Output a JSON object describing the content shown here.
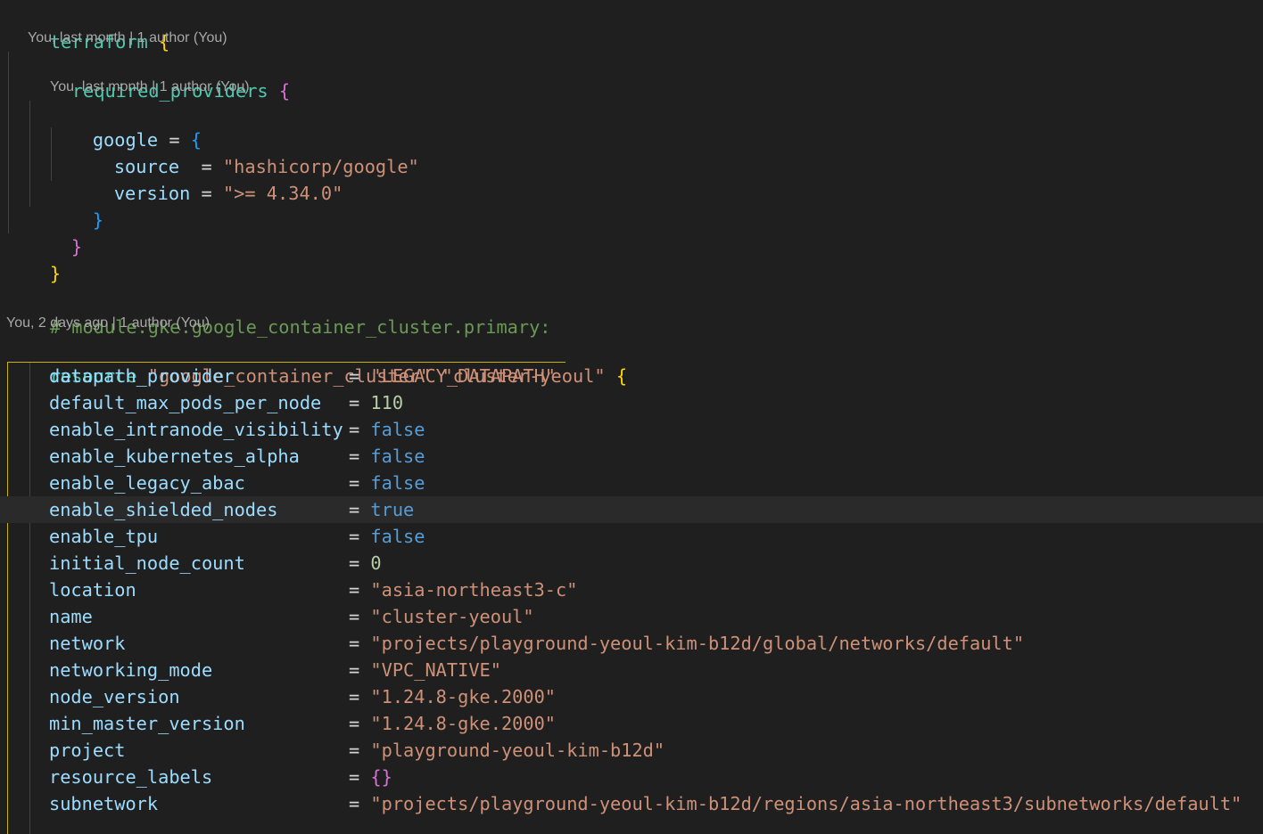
{
  "terraform_block": {
    "keyword": "terraform",
    "lens": "You, last month | 1 author (You)",
    "required_providers": {
      "keyword": "required_providers",
      "lens": "You, last month | 1 author (You)",
      "google": {
        "key": "google",
        "source_key": "source",
        "source_value": "\"hashicorp/google\"",
        "version_key": "version",
        "version_value": "\">= 4.34.0\""
      }
    }
  },
  "comment": "# module.gke.google_container_cluster.primary:",
  "resource_lens": "You, 2 days ago | 1 author (You)",
  "resource": {
    "keyword": "resource",
    "type": "\"google_container_cluster\"",
    "name": "\"cluster-yeoul\"",
    "attributes": [
      {
        "key": "datapath_provider",
        "value": "\"LEGACY_DATAPATH\"",
        "kind": "str"
      },
      {
        "key": "default_max_pods_per_node",
        "value": "110",
        "kind": "num"
      },
      {
        "key": "enable_intranode_visibility",
        "value": "false",
        "kind": "bool"
      },
      {
        "key": "enable_kubernetes_alpha",
        "value": "false",
        "kind": "bool"
      },
      {
        "key": "enable_legacy_abac",
        "value": "false",
        "kind": "bool"
      },
      {
        "key": "enable_shielded_nodes",
        "value": "true",
        "kind": "bool"
      },
      {
        "key": "enable_tpu",
        "value": "false",
        "kind": "bool"
      },
      {
        "key": "initial_node_count",
        "value": "0",
        "kind": "num"
      },
      {
        "key": "location",
        "value": "\"asia-northeast3-c\"",
        "kind": "str"
      },
      {
        "key": "name",
        "value": "\"cluster-yeoul\"",
        "kind": "str"
      },
      {
        "key": "network",
        "value": "\"projects/playground-yeoul-kim-b12d/global/networks/default\"",
        "kind": "str"
      },
      {
        "key": "networking_mode",
        "value": "\"VPC_NATIVE\"",
        "kind": "str"
      },
      {
        "key": "node_version",
        "value": "\"1.24.8-gke.2000\"",
        "kind": "str"
      },
      {
        "key": "min_master_version",
        "value": "\"1.24.8-gke.2000\"",
        "kind": "str"
      },
      {
        "key": "project",
        "value": "\"playground-yeoul-kim-b12d\"",
        "kind": "str"
      },
      {
        "key": "resource_labels",
        "value": "{}",
        "kind": "brace"
      },
      {
        "key": "subnetwork",
        "value": "\"projects/playground-yeoul-kim-b12d/regions/asia-northeast3/subnetworks/default\"",
        "kind": "str"
      }
    ]
  },
  "cursor_line_key": "enable_shielded_nodes",
  "colors": {
    "background": "#1f1f1f",
    "keyword": "#4ec9b0",
    "string": "#ce9178",
    "property": "#9cdcfe",
    "boolean": "#569cd6",
    "number": "#b5cea8",
    "comment": "#6a9955",
    "bracket_level1": "#ffd700",
    "bracket_level2": "#da70d6",
    "bracket_level3": "#179fff",
    "active_guide": "#c9b20a"
  }
}
